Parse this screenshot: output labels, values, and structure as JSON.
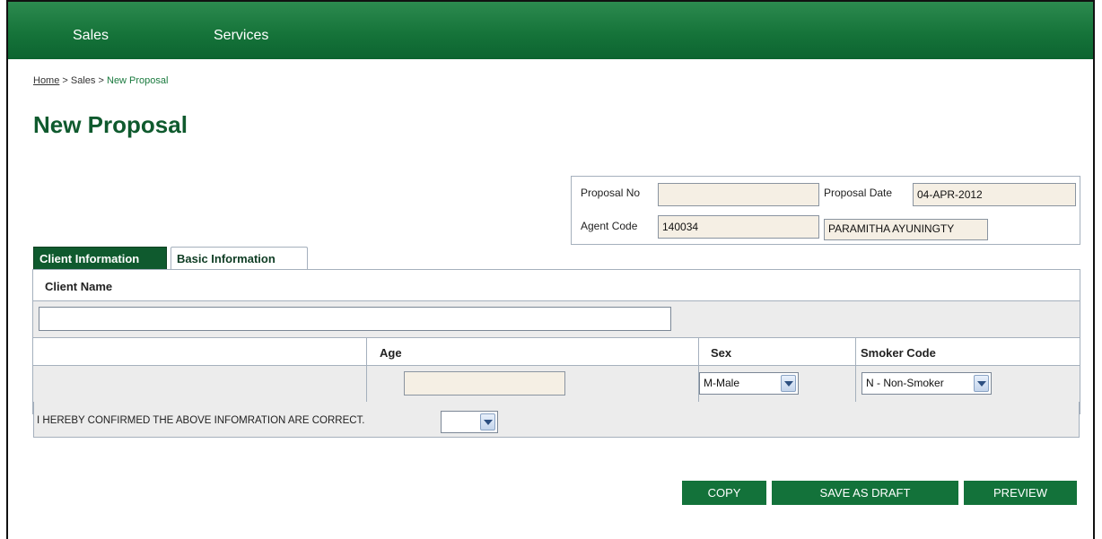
{
  "nav": {
    "items": [
      "Sales",
      "Services"
    ]
  },
  "breadcrumb": {
    "home": "Home",
    "sep1": ">",
    "sales": "Sales",
    "sep2": ">",
    "current": "New Proposal"
  },
  "page_title": "New Proposal",
  "proposal": {
    "proposal_no_label": "Proposal No",
    "proposal_no_value": "",
    "proposal_date_label": "Proposal Date",
    "proposal_date_value": "04-APR-2012",
    "agent_code_label": "Agent Code",
    "agent_code_value": "140034",
    "agent_name_value": "PARAMITHA  AYUNINGTY"
  },
  "tabs": [
    {
      "label": "Client Information",
      "active": true
    },
    {
      "label": "Basic Information",
      "active": false
    }
  ],
  "form": {
    "client_name_label": "Client Name",
    "client_name_value": "",
    "age_label": "Age",
    "age_value": "",
    "sex_label": "Sex",
    "sex_value": "M-Male",
    "smoker_label": "Smoker Code",
    "smoker_value": "N - Non-Smoker",
    "confirm_text": "I HEREBY CONFIRMED THE ABOVE INFOMRATION ARE CORRECT.",
    "confirm_value": ""
  },
  "buttons": {
    "copy": "COPY",
    "save_draft": "SAVE AS DRAFT",
    "preview": "PREVIEW"
  },
  "colors": {
    "nav_green": "#16743a",
    "title_green": "#0f5a2e",
    "button_green": "#13723a",
    "field_beige": "#f5efe4"
  }
}
